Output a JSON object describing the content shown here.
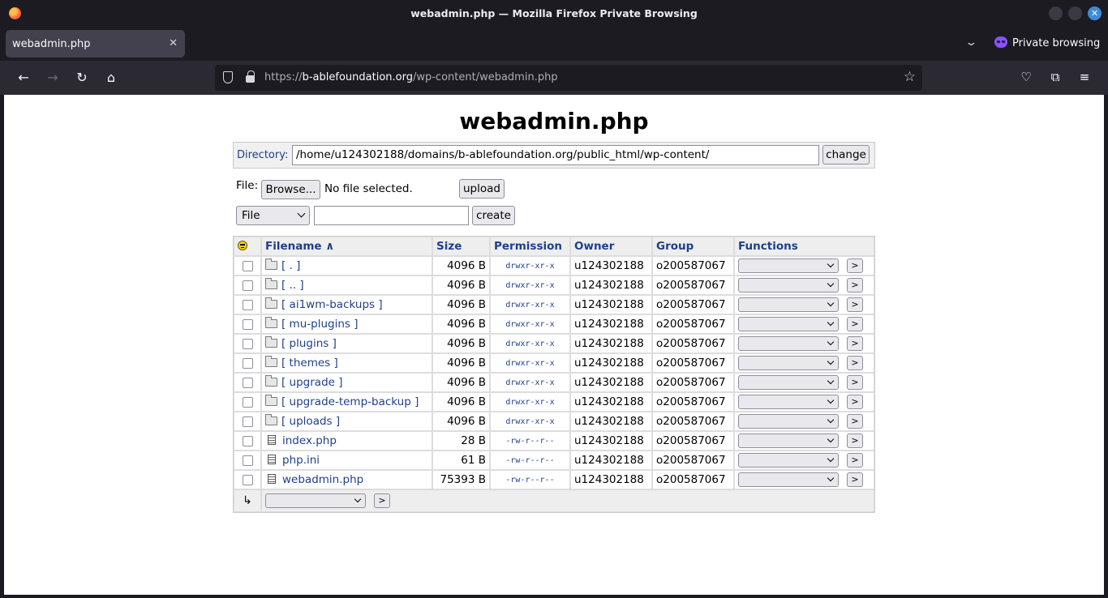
{
  "window": {
    "title": "webadmin.php — Mozilla Firefox Private Browsing"
  },
  "tab": {
    "label": "webadmin.php"
  },
  "private_label": "Private browsing",
  "urlbar": {
    "scheme": "https://",
    "host": "b-ablefoundation.org",
    "path": "/wp-content/webadmin.php"
  },
  "page": {
    "title": "webadmin.php",
    "directory_label": "Directory:",
    "directory_value": "/home/u124302188/domains/b-ablefoundation.org/public_html/wp-content/",
    "change_label": "change",
    "file_label": "File:",
    "browse_label": "Browse...",
    "no_file": "No file selected.",
    "upload_label": "upload",
    "create_type": "File",
    "create_label": "create"
  },
  "table": {
    "headers": {
      "filename": "Filename ∧",
      "size": "Size",
      "permission": "Permission",
      "owner": "Owner",
      "group": "Group",
      "functions": "Functions"
    },
    "go_label": ">",
    "rows": [
      {
        "type": "dir",
        "name": "[ . ]",
        "size": "4096 B",
        "perm": "drwxr-xr-x",
        "owner": "u124302188",
        "group": "o200587067"
      },
      {
        "type": "dir",
        "name": "[ .. ]",
        "size": "4096 B",
        "perm": "drwxr-xr-x",
        "owner": "u124302188",
        "group": "o200587067"
      },
      {
        "type": "dir",
        "name": "[ ai1wm-backups ]",
        "size": "4096 B",
        "perm": "drwxr-xr-x",
        "owner": "u124302188",
        "group": "o200587067"
      },
      {
        "type": "dir",
        "name": "[ mu-plugins ]",
        "size": "4096 B",
        "perm": "drwxr-xr-x",
        "owner": "u124302188",
        "group": "o200587067"
      },
      {
        "type": "dir",
        "name": "[ plugins ]",
        "size": "4096 B",
        "perm": "drwxr-xr-x",
        "owner": "u124302188",
        "group": "o200587067"
      },
      {
        "type": "dir",
        "name": "[ themes ]",
        "size": "4096 B",
        "perm": "drwxr-xr-x",
        "owner": "u124302188",
        "group": "o200587067"
      },
      {
        "type": "dir",
        "name": "[ upgrade ]",
        "size": "4096 B",
        "perm": "drwxr-xr-x",
        "owner": "u124302188",
        "group": "o200587067"
      },
      {
        "type": "dir",
        "name": "[ upgrade-temp-backup ]",
        "size": "4096 B",
        "perm": "drwxr-xr-x",
        "owner": "u124302188",
        "group": "o200587067"
      },
      {
        "type": "dir",
        "name": "[ uploads ]",
        "size": "4096 B",
        "perm": "drwxr-xr-x",
        "owner": "u124302188",
        "group": "o200587067"
      },
      {
        "type": "file",
        "name": "index.php",
        "size": "28 B",
        "perm": "-rw-r--r--",
        "owner": "u124302188",
        "group": "o200587067"
      },
      {
        "type": "file",
        "name": "php.ini",
        "size": "61 B",
        "perm": "-rw-r--r--",
        "owner": "u124302188",
        "group": "o200587067"
      },
      {
        "type": "file",
        "name": "webadmin.php",
        "size": "75393 B",
        "perm": "-rw-r--r--",
        "owner": "u124302188",
        "group": "o200587067"
      }
    ],
    "footer_arrow": "↳"
  }
}
